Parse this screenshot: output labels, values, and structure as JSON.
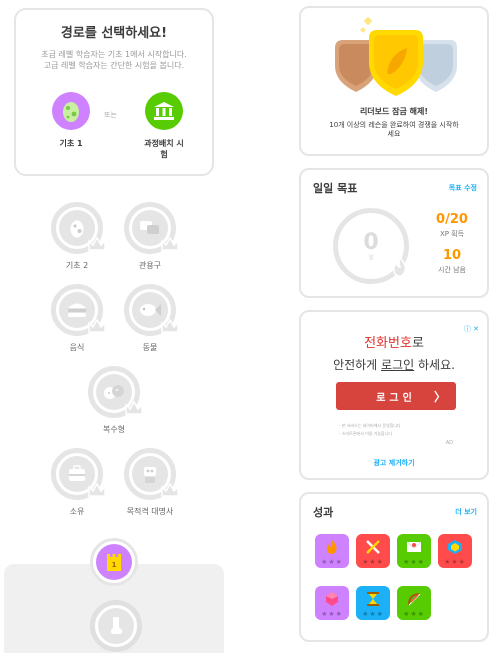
{
  "choose_path": {
    "title": "경로를 선택하세요!",
    "desc_line1": "초급 레벨 학습자는 기초 1에서 시작합니다.",
    "desc_line2": "고급 레벨 학습자는 간단한 시험을 봅니다.",
    "or_label": "또는",
    "option1_label": "기초 1",
    "option2_label_line1": "과정배치 시",
    "option2_label_line2": "험"
  },
  "skills": [
    {
      "name": "기초 2",
      "icon": "egg-icon"
    },
    {
      "name": "관용구",
      "icon": "speech-bubbles-icon"
    },
    {
      "name": "음식",
      "icon": "burger-icon"
    },
    {
      "name": "동물",
      "icon": "fish-icon"
    },
    {
      "name": "복수형",
      "icon": "cookies-icon"
    },
    {
      "name": "소유",
      "icon": "suitcase-icon"
    },
    {
      "name": "목적격 대명사",
      "icon": "robot-icon"
    }
  ],
  "checkpoint": {
    "number": "1"
  },
  "leaderboard": {
    "title": "리더보드 잠금 해제!",
    "desc_line1": "10개 이상의 레슨을 완료하여 경쟁을 시작하",
    "desc_line2": "세요"
  },
  "daily_goal": {
    "title": "일일 목표",
    "edit_link": "목표 수정",
    "ring_value": "0",
    "ring_unit": "일",
    "xp_value": "0/20",
    "xp_label": "XP 획득",
    "time_value": "10",
    "time_label": "시간 남음"
  },
  "ad": {
    "marks": "ⓘ ✕",
    "line1_red": "전화번호",
    "line1_rest": "로",
    "line2_pre": "안전하게 ",
    "line2_u": "로그인",
    "line2_post": " 하세요.",
    "button": "로그인",
    "button_arrow": "〉",
    "fine1": "- 본 서비스는 네이버에서 운영합니다",
    "fine2": "- 스마트폰에서 이용 가능합니다",
    "tag": "AD",
    "remove": "광고 제거하기"
  },
  "achievements": {
    "title": "성과",
    "more_link": "더 보기",
    "badges": [
      {
        "name": "flame",
        "color": "#ce82ff"
      },
      {
        "name": "crossed-swords",
        "color": "#ff4b4b"
      },
      {
        "name": "envelope",
        "color": "#58cc02"
      },
      {
        "name": "medal",
        "color": "#ff4b4b"
      },
      {
        "name": "gem",
        "color": "#ce82ff"
      },
      {
        "name": "hourglass",
        "color": "#1cb0f6"
      },
      {
        "name": "bow",
        "color": "#58cc02"
      }
    ]
  },
  "colors": {
    "accent_blue": "#1cb0f6",
    "orange": "#ff9600",
    "purple": "#ce82ff",
    "green": "#58cc02",
    "ad_red": "#d7443e"
  }
}
